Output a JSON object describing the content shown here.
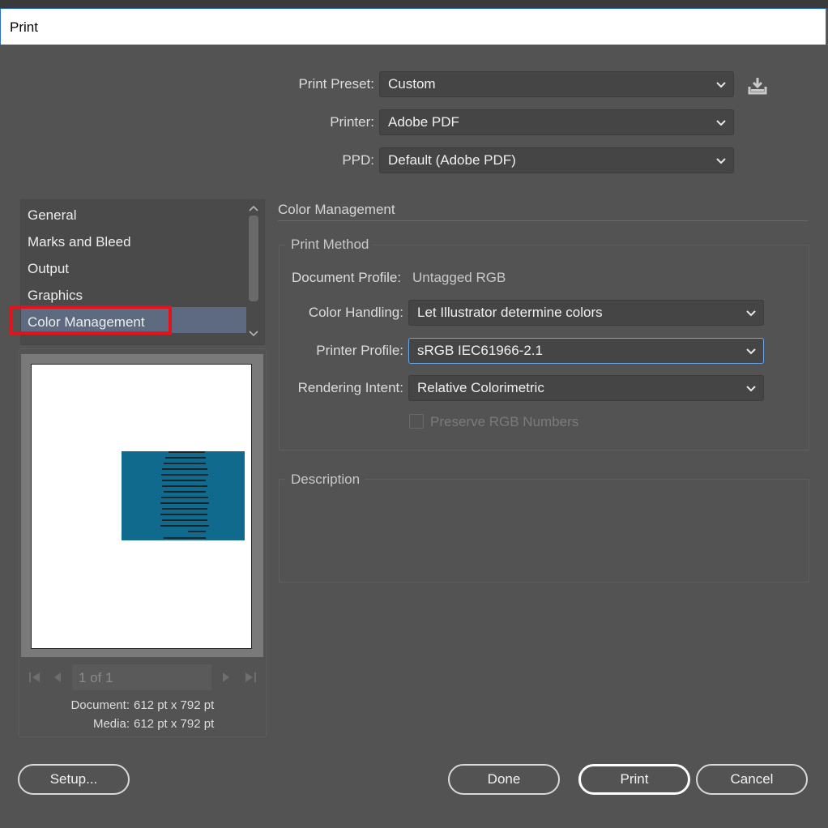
{
  "window": {
    "title": "Print"
  },
  "top": {
    "preset_label": "Print Preset:",
    "preset_value": "Custom",
    "printer_label": "Printer:",
    "printer_value": "Adobe PDF",
    "ppd_label": "PPD:",
    "ppd_value": "Default (Adobe PDF)",
    "save_preset_icon": "save-preset-icon"
  },
  "sidebar": {
    "items": [
      {
        "label": "General"
      },
      {
        "label": "Marks and Bleed"
      },
      {
        "label": "Output"
      },
      {
        "label": "Graphics"
      },
      {
        "label": "Color Management",
        "selected": true
      }
    ]
  },
  "preview": {
    "page_indicator": "1 of 1",
    "document_label": "Document:",
    "document_value": "612 pt x 792 pt",
    "media_label": "Media:",
    "media_value": "612 pt x 792 pt"
  },
  "main": {
    "section_title": "Color Management",
    "print_method": {
      "title": "Print Method",
      "doc_profile_label": "Document Profile:",
      "doc_profile_value": "Untagged RGB",
      "color_handling_label": "Color Handling:",
      "color_handling_value": "Let Illustrator determine colors",
      "printer_profile_label": "Printer Profile:",
      "printer_profile_value": "sRGB IEC61966-2.1",
      "rendering_intent_label": "Rendering Intent:",
      "rendering_intent_value": "Relative Colorimetric",
      "preserve_label": "Preserve RGB Numbers",
      "preserve_checked": false
    },
    "description": {
      "title": "Description"
    }
  },
  "buttons": {
    "setup": "Setup...",
    "done": "Done",
    "print": "Print",
    "cancel": "Cancel"
  },
  "colors": {
    "background": "#535353",
    "selection": "#5d6a80",
    "highlight_box": "#e5121b",
    "artwork": "#0f6a8d"
  }
}
